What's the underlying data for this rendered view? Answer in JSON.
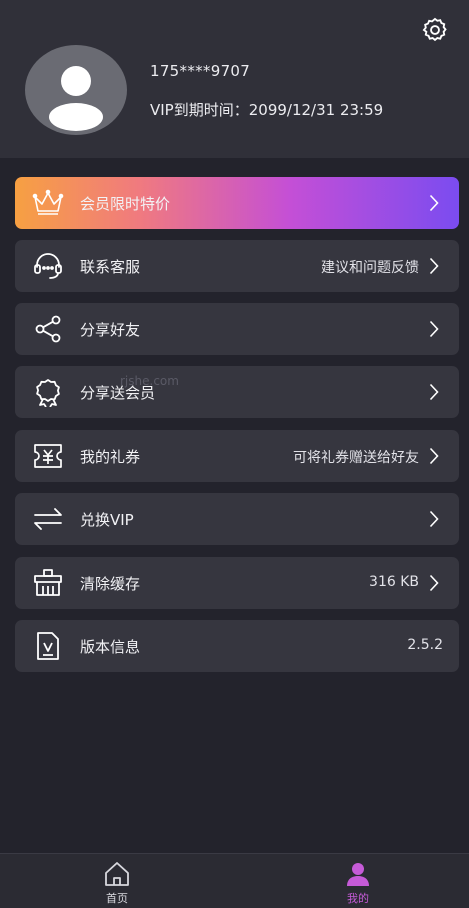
{
  "profile": {
    "phone": "175****9707",
    "vip_expire": "VIP到期时间：2099/12/31 23:59"
  },
  "menu": [
    {
      "label": "会员限时特价",
      "value": "",
      "icon": "crown-icon"
    },
    {
      "label": "联系客服",
      "value": "建议和问题反馈",
      "icon": "headset-icon"
    },
    {
      "label": "分享好友",
      "value": "",
      "icon": "share-icon"
    },
    {
      "label": "分享送会员",
      "value": "",
      "icon": "badge-icon"
    },
    {
      "label": "我的礼券",
      "value": "可将礼券赠送给好友",
      "icon": "coupon-icon"
    },
    {
      "label": "兑换VIP",
      "value": "",
      "icon": "exchange-icon"
    },
    {
      "label": "清除缓存",
      "value": "316 KB",
      "icon": "broom-icon"
    },
    {
      "label": "版本信息",
      "value": "2.5.2",
      "icon": "document-icon"
    }
  ],
  "watermark": "rjshe.com",
  "tabs": [
    {
      "label": "首页",
      "icon": "home-icon",
      "active": false
    },
    {
      "label": "我的",
      "icon": "user-icon",
      "active": true
    }
  ],
  "colors": {
    "background": "#23232c",
    "header": "#303039",
    "card": "#36363f",
    "accent": "#c65bd8",
    "promo_gradient": [
      "#f7a042",
      "#c44fd6",
      "#7b4cf0"
    ]
  }
}
